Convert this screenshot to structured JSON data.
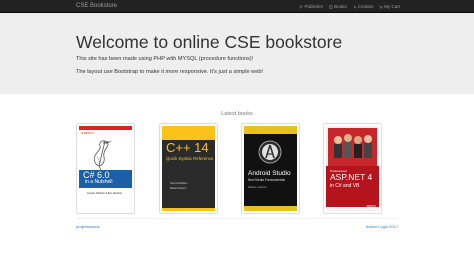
{
  "navbar": {
    "brand": "CSE Bookstore",
    "items": [
      {
        "label": "Publisher",
        "icon": "paperclip-icon"
      },
      {
        "label": "Books",
        "icon": "book-icon"
      },
      {
        "label": "Contact",
        "icon": "phone-icon"
      },
      {
        "label": "My Cart",
        "icon": "cart-icon"
      }
    ]
  },
  "jumbotron": {
    "title": "Welcome to online CSE bookstore",
    "line1": "This site has been made using PHP with MYSQL (procedure functions)!",
    "line2": "The layout use Bootstrap to make it more responsive. It's just a simple web!"
  },
  "latest": {
    "heading": "Latest books",
    "books": [
      {
        "publisher": "O'REILLY",
        "title": "C# 6.0",
        "subtitle": "in a Nutshell",
        "authors": "Joseph Albahari & Ben Albahari"
      },
      {
        "title": "C++ 14",
        "subtitle": "Quick Syntax Reference",
        "edition": "Second Edition",
        "author": "Mikael Olsson",
        "publisher": "Apress"
      },
      {
        "title": "Android Studio",
        "subtitle": "New Media Fundamentals",
        "author": "Wallace Jackson"
      },
      {
        "series": "Professional",
        "title": "ASP.NET 4",
        "subtitle": "in C# and VB",
        "publisher": "WROX"
      }
    ]
  },
  "footer": {
    "left": "projectworlds",
    "right": "Admin Login 2017"
  },
  "colors": {
    "navbar_bg": "#222222",
    "jumbotron_bg": "#eeeeee",
    "link": "#337ab7"
  }
}
